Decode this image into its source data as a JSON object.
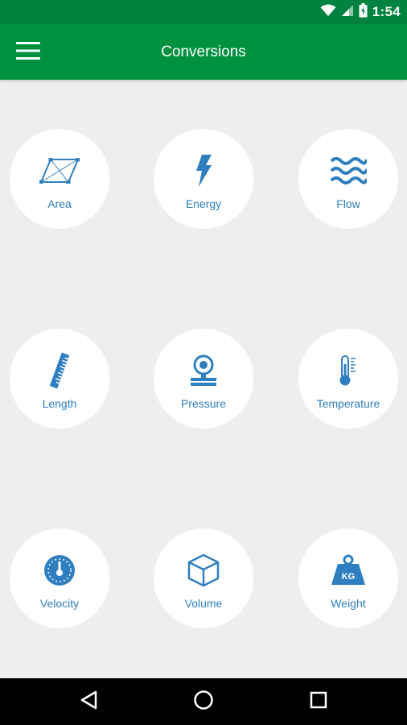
{
  "status_bar": {
    "time": "1:54",
    "icons": [
      "wifi-icon",
      "cellular-signal-icon",
      "battery-charging-icon"
    ]
  },
  "app_bar": {
    "title": "Conversions",
    "menu_icon": "hamburger-menu-icon"
  },
  "colors": {
    "status_bar": "#00833e",
    "app_bar": "#00913f",
    "background": "#eeeeee",
    "tile": "#ffffff",
    "accent": "#2f7fc0",
    "nav_bar": "#000000"
  },
  "conversions": [
    {
      "label": "Area",
      "icon": "area-icon"
    },
    {
      "label": "Energy",
      "icon": "energy-icon"
    },
    {
      "label": "Flow",
      "icon": "flow-icon"
    },
    {
      "label": "Length",
      "icon": "length-icon"
    },
    {
      "label": "Pressure",
      "icon": "pressure-icon"
    },
    {
      "label": "Temperature",
      "icon": "temperature-icon"
    },
    {
      "label": "Velocity",
      "icon": "velocity-icon"
    },
    {
      "label": "Volume",
      "icon": "volume-icon"
    },
    {
      "label": "Weight",
      "icon": "weight-icon",
      "icon_text": "KG"
    }
  ],
  "nav_bar": {
    "buttons": [
      "back-icon",
      "home-icon",
      "recents-icon"
    ]
  }
}
